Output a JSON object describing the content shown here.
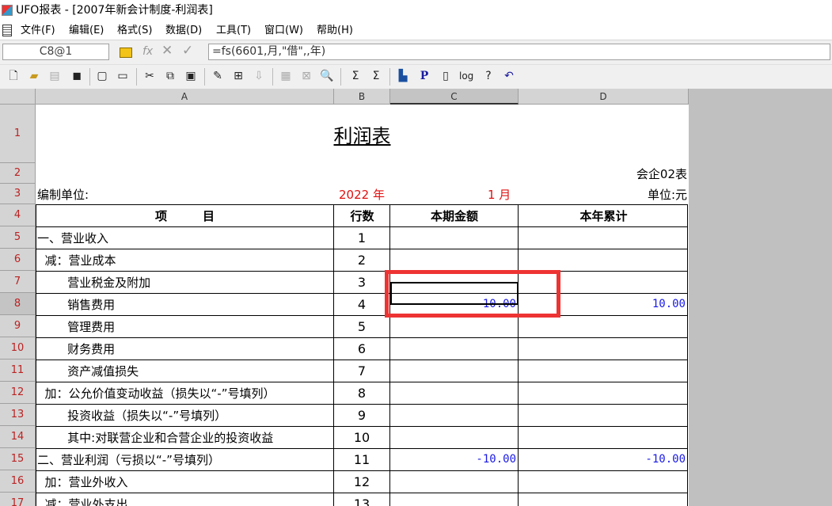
{
  "window": {
    "title": "UFO报表 - [2007年新会计制度-利润表]"
  },
  "menu": [
    "文件(F)",
    "编辑(E)",
    "格式(S)",
    "数据(D)",
    "工具(T)",
    "窗口(W)",
    "帮助(H)"
  ],
  "formula_bar": {
    "cell_ref": "C8@1",
    "fx": "fx",
    "cancel": "✕",
    "accept": "✓",
    "formula": "=fs(6601,月,\"借\",,年)"
  },
  "columns": [
    "A",
    "B",
    "C",
    "D"
  ],
  "rows": [
    "1",
    "2",
    "3",
    "4",
    "5",
    "6",
    "7",
    "8",
    "9",
    "10",
    "11",
    "12",
    "13",
    "14",
    "15",
    "16",
    "17"
  ],
  "report": {
    "title": "利润表",
    "form_code": "会企02表",
    "unit_label": "编制单位:",
    "year": "2022 年",
    "month": "1 月",
    "currency": "单位:元",
    "headers": {
      "item": "项　　　目",
      "line": "行数",
      "current": "本期金额",
      "ytd": "本年累计"
    },
    "lines": [
      {
        "item": "一、营业收入",
        "line": "1",
        "current": "",
        "ytd": ""
      },
      {
        "item": "  减：营业成本",
        "line": "2",
        "current": "",
        "ytd": ""
      },
      {
        "item": "        营业税金及附加",
        "line": "3",
        "current": "",
        "ytd": ""
      },
      {
        "item": "        销售费用",
        "line": "4",
        "current": "10.00",
        "ytd": "10.00"
      },
      {
        "item": "        管理费用",
        "line": "5",
        "current": "",
        "ytd": ""
      },
      {
        "item": "        财务费用",
        "line": "6",
        "current": "",
        "ytd": ""
      },
      {
        "item": "        资产减值损失",
        "line": "7",
        "current": "",
        "ytd": ""
      },
      {
        "item": "  加：公允价值变动收益（损失以“-”号填列）",
        "line": "8",
        "current": "",
        "ytd": ""
      },
      {
        "item": "        投资收益（损失以“-”号填列）",
        "line": "9",
        "current": "",
        "ytd": ""
      },
      {
        "item": "        其中:对联营企业和合营企业的投资收益",
        "line": "10",
        "current": "",
        "ytd": ""
      },
      {
        "item": "二、营业利润（亏损以“-”号填列）",
        "line": "11",
        "current": "-10.00",
        "ytd": "-10.00"
      },
      {
        "item": "  加：营业外收入",
        "line": "12",
        "current": "",
        "ytd": ""
      },
      {
        "item": "  减：营业外支出",
        "line": "13",
        "current": "",
        "ytd": ""
      }
    ]
  }
}
